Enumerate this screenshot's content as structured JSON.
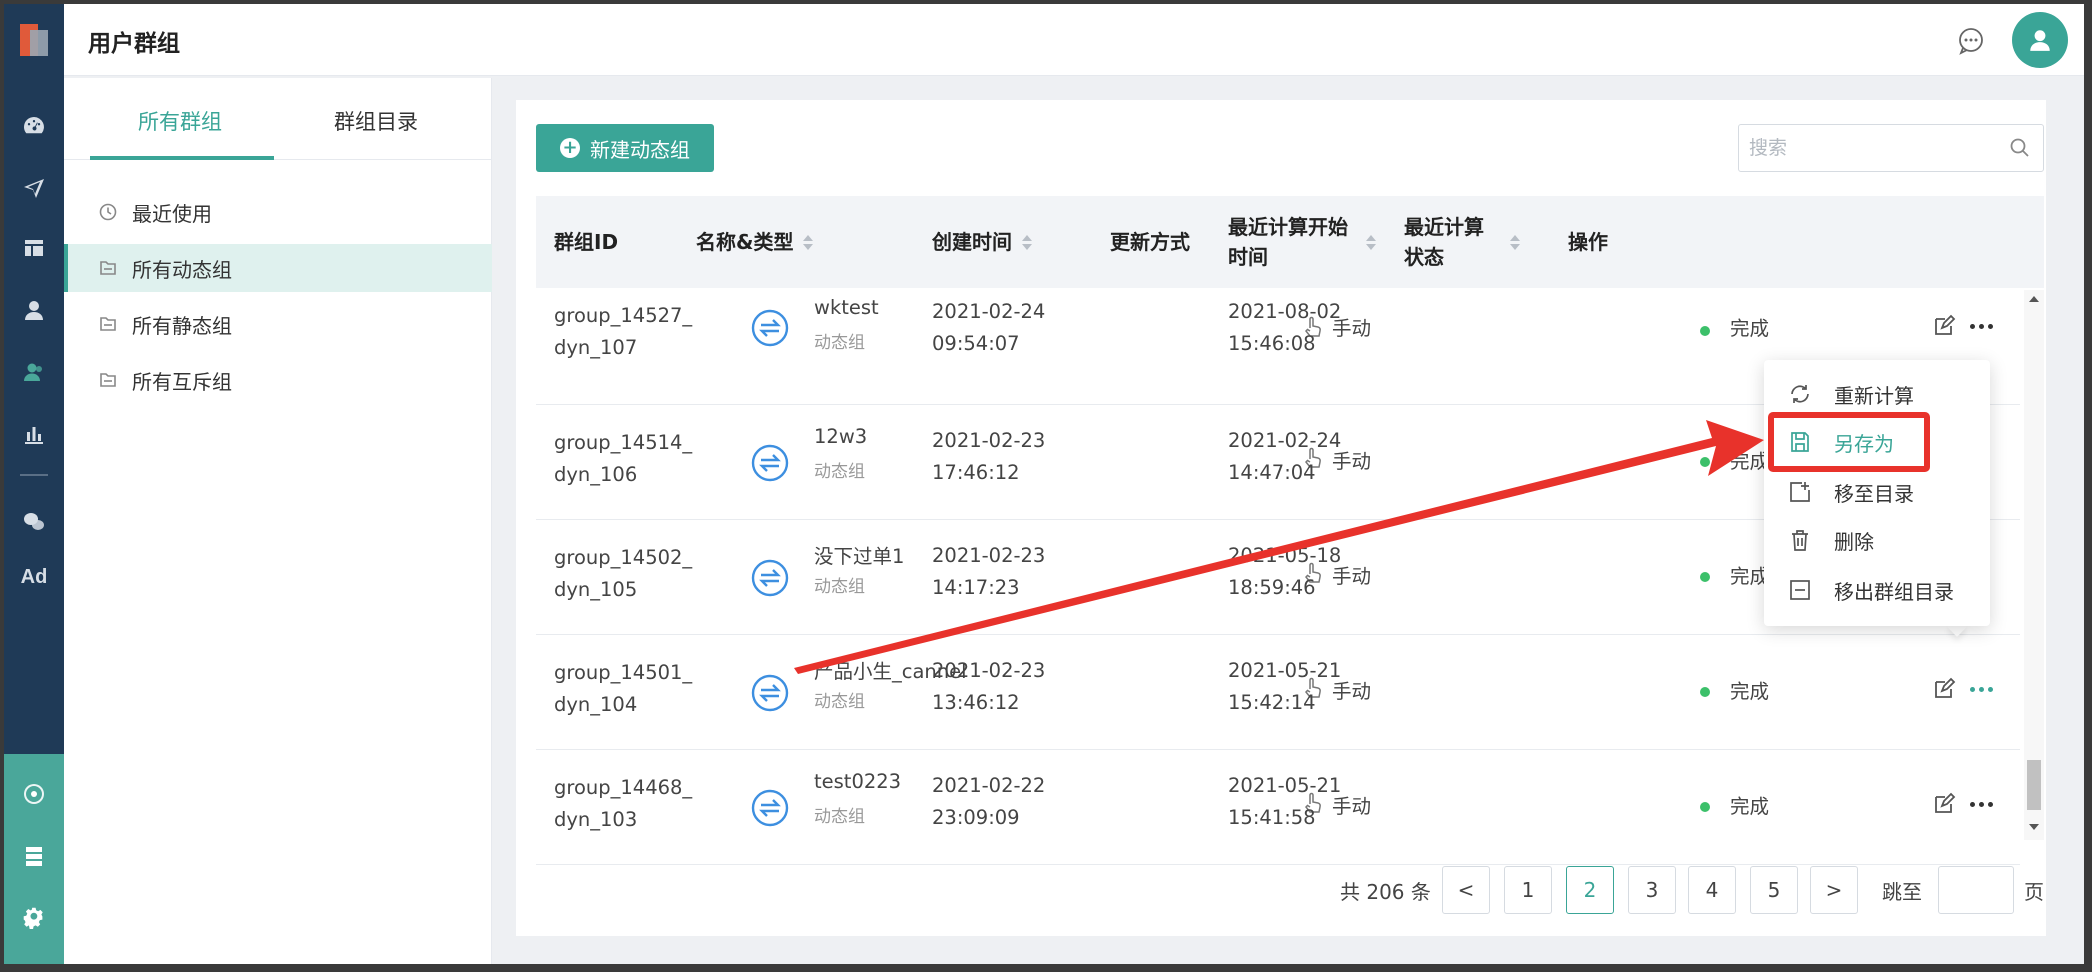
{
  "header": {
    "title": "用户群组"
  },
  "tree": {
    "tabs": [
      "所有群组",
      "群组目录"
    ],
    "items": [
      "最近使用",
      "所有动态组",
      "所有静态组",
      "所有互斥组"
    ]
  },
  "toolbar": {
    "new_label": "新建动态组",
    "search_placeholder": "搜索"
  },
  "table": {
    "columns": [
      "群组ID",
      "名称&类型",
      "创建时间",
      "更新方式",
      "最近计算开始时间",
      "最近计算状态",
      "操作"
    ],
    "rows": [
      {
        "id_1": "group_14527_",
        "id_2": "dyn_107",
        "name": "wktest",
        "type": "动态组",
        "created_date": "2021-02-24",
        "created_time": "09:54:07",
        "update": "手动",
        "calc_date": "2021-08-02",
        "calc_time": "15:46:08",
        "status": "完成"
      },
      {
        "id_1": "group_14514_",
        "id_2": "dyn_106",
        "name": "12w3",
        "type": "动态组",
        "created_date": "2021-02-23",
        "created_time": "17:46:12",
        "update": "手动",
        "calc_date": "2021-02-24",
        "calc_time": "14:47:04",
        "status": "完成"
      },
      {
        "id_1": "group_14502_",
        "id_2": "dyn_105",
        "name": "没下过单1",
        "type": "动态组",
        "created_date": "2021-02-23",
        "created_time": "14:17:23",
        "update": "手动",
        "calc_date": "2021-05-18",
        "calc_time": "18:59:46",
        "status": "完成"
      },
      {
        "id_1": "group_14501_",
        "id_2": "dyn_104",
        "name": "产品小生_cannel",
        "type": "动态组",
        "created_date": "2021-02-23",
        "created_time": "13:46:12",
        "update": "手动",
        "calc_date": "2021-05-21",
        "calc_time": "15:42:14",
        "status": "完成"
      },
      {
        "id_1": "group_14468_",
        "id_2": "dyn_103",
        "name": "test0223",
        "type": "动态组",
        "created_date": "2021-02-22",
        "created_time": "23:09:09",
        "update": "手动",
        "calc_date": "2021-05-21",
        "calc_time": "15:41:58",
        "status": "完成"
      }
    ]
  },
  "pagination": {
    "total": "共 206 条",
    "prev": "<",
    "next": ">",
    "pages": [
      "1",
      "2",
      "3",
      "4",
      "5"
    ],
    "current": "2",
    "jump_label": "跳至",
    "jump_unit": "页"
  },
  "menu": {
    "items": [
      "重新计算",
      "另存为",
      "移至目录",
      "删除",
      "移出群组目录"
    ],
    "active": "另存为"
  },
  "colors": {
    "accent": "#3aa597",
    "sidebar": "#1f3a57",
    "annotation": "#e8322b",
    "status_ok": "#3cc06a"
  },
  "icons": [
    "dashboard-icon",
    "send-icon",
    "layout-icon",
    "user-icon",
    "users-icon",
    "bar-chart-icon",
    "wechat-icon",
    "sync-icon",
    "hand-icon",
    "edit-icon",
    "more-icon",
    "chat-icon",
    "search-icon",
    "gear-icon"
  ]
}
